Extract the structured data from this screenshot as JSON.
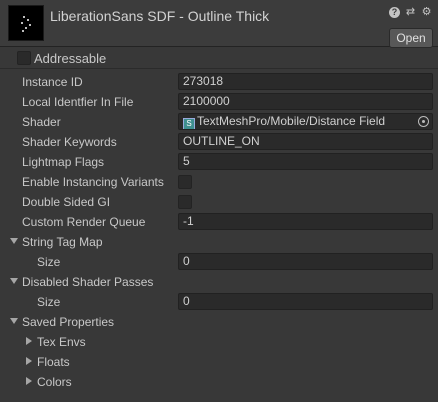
{
  "header": {
    "title": "LiberationSans SDF - Outline Thick",
    "open_label": "Open",
    "icons": [
      "help-icon",
      "sliders-icon",
      "gear-icon"
    ]
  },
  "addressable": {
    "label": "Addressable",
    "checked": false
  },
  "fields": {
    "instance_id": {
      "label": "Instance ID",
      "value": "273018"
    },
    "local_identifier": {
      "label": "Local Identfier In File",
      "value": "2100000"
    },
    "shader": {
      "label": "Shader",
      "value": "TextMeshPro/Mobile/Distance Field"
    },
    "shader_keywords": {
      "label": "Shader Keywords",
      "value": "OUTLINE_ON"
    },
    "lightmap_flags": {
      "label": "Lightmap Flags",
      "value": "5"
    },
    "enable_instancing": {
      "label": "Enable Instancing Variants",
      "checked": false
    },
    "double_sided_gi": {
      "label": "Double Sided GI",
      "checked": false
    },
    "custom_render_queue": {
      "label": "Custom Render Queue",
      "value": "-1"
    }
  },
  "string_tag_map": {
    "label": "String Tag Map",
    "size_label": "Size",
    "size": "0"
  },
  "disabled_shader_passes": {
    "label": "Disabled Shader Passes",
    "size_label": "Size",
    "size": "0"
  },
  "saved_properties": {
    "label": "Saved Properties",
    "children": [
      "Tex Envs",
      "Floats",
      "Colors"
    ]
  }
}
